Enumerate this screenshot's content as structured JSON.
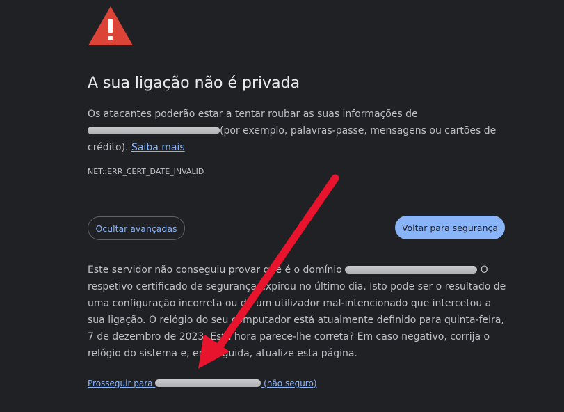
{
  "interstitial": {
    "warning_icon": "warning-triangle-icon",
    "warning_color": "#db4437",
    "title": "A sua ligação não é privada",
    "summary_before": "Os atacantes poderão estar a tentar roubar as suas informações de",
    "summary_after": "(por exemplo, palavras-passe, mensagens ou cartões de crédito).",
    "learn_more_label": "Saiba mais",
    "error_code": "NET::ERR_CERT_DATE_INVALID"
  },
  "actions": {
    "hide_advanced_label": "Ocultar avançadas",
    "back_to_safety_label": "Voltar para segurança"
  },
  "details": {
    "text_before": "Este servidor não conseguiu provar que é o domínio",
    "text_after": "O respetivo certificado de segurança expirou no último dia. Isto pode ser o resultado de uma configuração incorreta ou de um utilizador mal-intencionado que intercetou a sua ligação. O relógio do seu computador está atualmente definido para quinta-feira, 7 de dezembro de 2023. Esta hora parece-lhe correta? Em caso negativo, corrija o relógio do sistema e, em seguida, atualize esta página.",
    "proceed_prefix": "Prosseguir para",
    "proceed_suffix": "(não seguro)"
  },
  "annotation": {
    "arrow_color": "#e8132d"
  },
  "colors": {
    "background": "#202124",
    "text": "#bdc1c6",
    "title": "#e8eaed",
    "link": "#8ab4f8",
    "primary_button": "#8ab4f8"
  }
}
